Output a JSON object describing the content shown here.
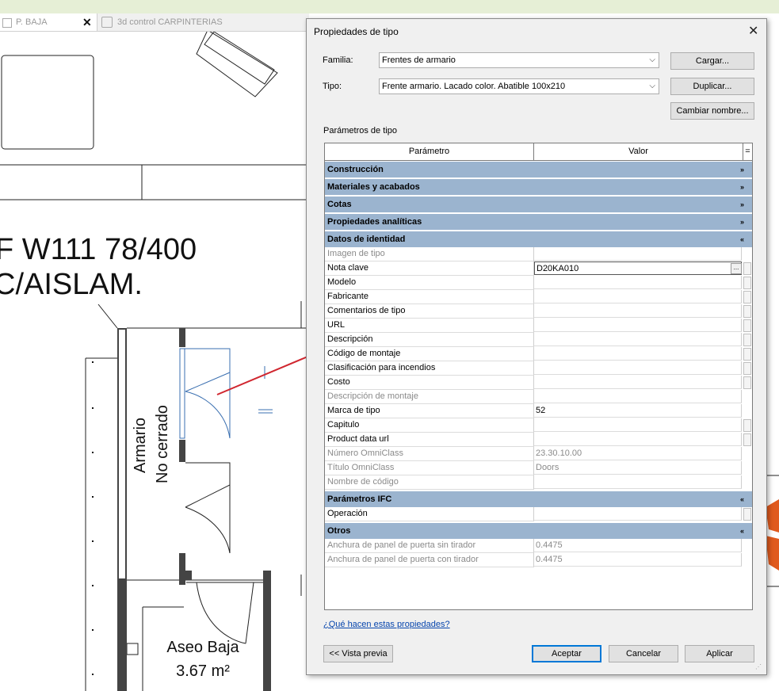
{
  "tabs": [
    {
      "label": "P. BAJA",
      "close": "✕"
    },
    {
      "label": "3d control CARPINTERIAS"
    }
  ],
  "drawing": {
    "line1": "F W111 78/400",
    "line2": "C/AISLAM.",
    "rot1": "Armario",
    "rot2": "No cerrado",
    "room1": "Aseo Baja",
    "room2": "3.67 m²"
  },
  "dialog": {
    "title": "Propiedades de tipo",
    "close": "✕",
    "family_label": "Familia:",
    "family_value": "Frentes de armario",
    "type_label": "Tipo:",
    "type_value": "Frente armario. Lacado color. Abatible 100x210",
    "load_btn": "Cargar...",
    "duplicate_btn": "Duplicar...",
    "rename_btn": "Cambiar nombre...",
    "params_title": "Parámetros de tipo",
    "col_param": "Parámetro",
    "col_value": "Valor",
    "col_eq": "=",
    "help_link": "¿Qué hacen estas propiedades?",
    "preview_btn": "<< Vista previa",
    "ok_btn": "Aceptar",
    "cancel_btn": "Cancelar",
    "apply_btn": "Aplicar"
  },
  "groups": [
    {
      "label": "Construcción",
      "chev": "»"
    },
    {
      "label": "Materiales y acabados",
      "chev": "»"
    },
    {
      "label": "Cotas",
      "chev": "»"
    },
    {
      "label": "Propiedades analíticas",
      "chev": "»"
    },
    {
      "label": "Datos de identidad",
      "chev": "«"
    },
    {
      "label": "Parámetros IFC",
      "chev": "«"
    },
    {
      "label": "Otros",
      "chev": "«"
    }
  ],
  "params": [
    {
      "name": "Imagen de tipo",
      "value": ""
    },
    {
      "name": "Nota clave",
      "value": "D20KA010",
      "dots": "..."
    },
    {
      "name": "Modelo",
      "value": ""
    },
    {
      "name": "Fabricante",
      "value": ""
    },
    {
      "name": "Comentarios de tipo",
      "value": ""
    },
    {
      "name": "URL",
      "value": ""
    },
    {
      "name": "Descripción",
      "value": ""
    },
    {
      "name": "Código de montaje",
      "value": ""
    },
    {
      "name": "Clasificación para incendios",
      "value": ""
    },
    {
      "name": "Costo",
      "value": ""
    },
    {
      "name": "Descripción de montaje",
      "value": ""
    },
    {
      "name": "Marca de tipo",
      "value": "52"
    },
    {
      "name": "Capitulo",
      "value": ""
    },
    {
      "name": "Product data url",
      "value": ""
    },
    {
      "name": "Número OmniClass",
      "value": "23.30.10.00"
    },
    {
      "name": "Título OmniClass",
      "value": "Doors"
    },
    {
      "name": "Nombre de código",
      "value": ""
    },
    {
      "name": "Operación",
      "value": ""
    },
    {
      "name": "Anchura de panel de puerta sin tirador",
      "value": "0.4475"
    },
    {
      "name": "Anchura de panel de puerta con tirador",
      "value": "0.4475"
    }
  ],
  "colors": {
    "group_bg": "#9bb4cf",
    "arrow": "#d0262f",
    "door": "#3a6fb0"
  }
}
